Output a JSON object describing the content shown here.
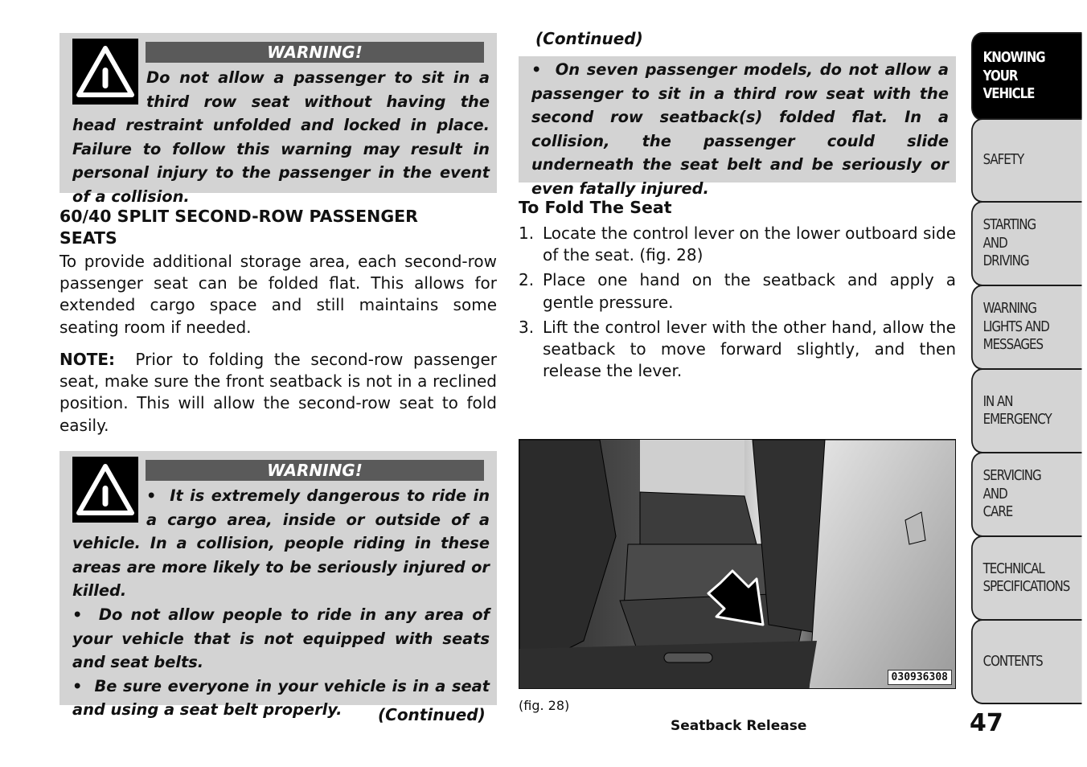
{
  "left_column": {
    "warning1": {
      "title": "WARNING!",
      "text": "Do not allow a passenger to sit in a third row seat without having the head restraint unfolded and locked in place. Failure to follow this warning may result in personal injury to the passenger in the event of a collision."
    },
    "section_heading": "60/40 SPLIT SECOND-ROW PASSENGER SEATS",
    "intro_paragraph": "To provide additional storage area, each second-row passenger seat can be folded flat. This allows for extended cargo space and still maintains some seating room if needed.",
    "note": {
      "label": "NOTE:",
      "text": "Prior to folding the second-row passenger seat, make sure the front seatback is not in a reclined position. This will allow the second-row seat to fold easily."
    },
    "warning2": {
      "title": "WARNING!",
      "bullets": [
        "It is extremely dangerous to ride in a cargo area, inside or outside of a vehicle. In a collision, people riding in these areas are more likely to be seriously injured or killed.",
        "Do not allow people to ride in any area of your vehicle that is not equipped with seats and seat belts.",
        "Be sure everyone in your vehicle is in a seat and using a seat belt properly."
      ]
    },
    "continued_label": "(Continued)"
  },
  "right_column": {
    "continued_label": "(Continued)",
    "continued_warning": "On seven passenger models, do not allow a passenger to sit in a third row seat with the second row seatback(s) folded flat. In a collision, the passenger could slide underneath the seat belt and be seriously or even fatally injured.",
    "procedure_heading": "To Fold The Seat",
    "steps": [
      {
        "num": "1.",
        "text": "Locate the control lever on the lower outboard side of the seat. (fig.  28)"
      },
      {
        "num": "2.",
        "text": "Place one hand on the seatback and apply a gentle pressure."
      },
      {
        "num": "3.",
        "text": "Lift the control lever with the other hand, allow the seatback to move forward slightly, and then release the lever."
      }
    ],
    "figure": {
      "code": "030936308",
      "caption_ref": "(fig. 28)",
      "caption": "Seatback Release"
    }
  },
  "side_tabs": [
    {
      "label": "KNOWING\nYOUR\nVEHICLE",
      "active": true
    },
    {
      "label": "SAFETY",
      "active": false
    },
    {
      "label": "STARTING\nAND\nDRIVING",
      "active": false
    },
    {
      "label": "WARNING\nLIGHTS AND\nMESSAGES",
      "active": false
    },
    {
      "label": "IN AN\nEMERGENCY",
      "active": false
    },
    {
      "label": "SERVICING\nAND\nCARE",
      "active": false
    },
    {
      "label": "TECHNICAL\nSPECIFICATIONS",
      "active": false
    },
    {
      "label": "CONTENTS",
      "active": false
    }
  ],
  "page_number": "47",
  "colors": {
    "warning_box_bg": "#d3d3d3",
    "warning_bar_bg": "#5a5a5a",
    "active_tab_bg": "#000000",
    "inactive_tab_bg": "#d4d4d4"
  }
}
